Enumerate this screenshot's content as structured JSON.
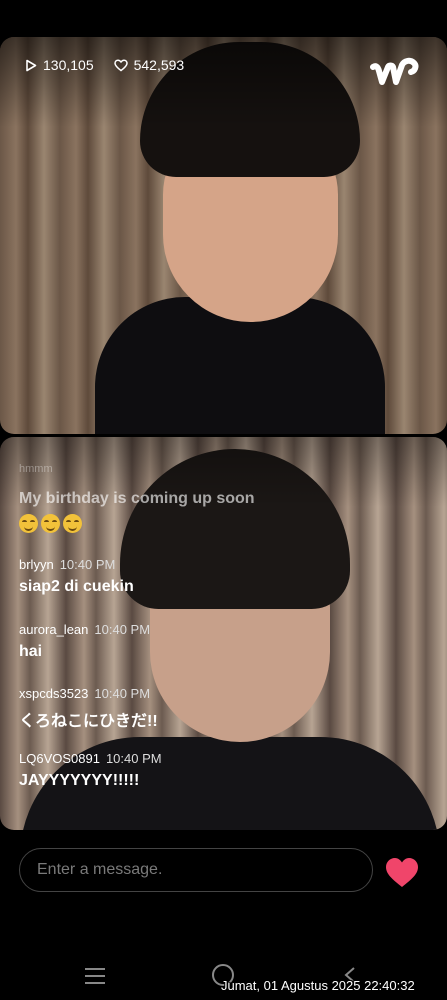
{
  "stats": {
    "views": "130,105",
    "likes": "542,593"
  },
  "chat": {
    "faded_text": "hmmm",
    "pinned_message": "My birthday is coming up soon",
    "pinned_emoji": [
      "smiling-face",
      "smiling-face",
      "smiling-face"
    ],
    "messages": [
      {
        "user": "brlyyn",
        "time": "10:40 PM",
        "text": "siap2 di cuekin"
      },
      {
        "user": "aurora_lean",
        "time": "10:40 PM",
        "text": "hai"
      },
      {
        "user": "xspcds3523",
        "time": "10:40 PM",
        "text": "くろねこにひきだ!!"
      },
      {
        "user": "LQ6VOS0891",
        "time": "10:40 PM",
        "text": "JAYYYYYYY!!!!!"
      }
    ]
  },
  "input": {
    "placeholder": "Enter a message."
  },
  "colors": {
    "heart": "#f0456a",
    "accent": "#ffffff"
  },
  "icons": {
    "views": "play-icon",
    "likes": "heart-outline-icon",
    "logo": "weverse-logo",
    "send_like": "heart-icon",
    "nav": [
      "menu-icon",
      "home-icon",
      "back-icon"
    ]
  },
  "timestamp": "Jumat, 01 Agustus 2025 22:40:32"
}
